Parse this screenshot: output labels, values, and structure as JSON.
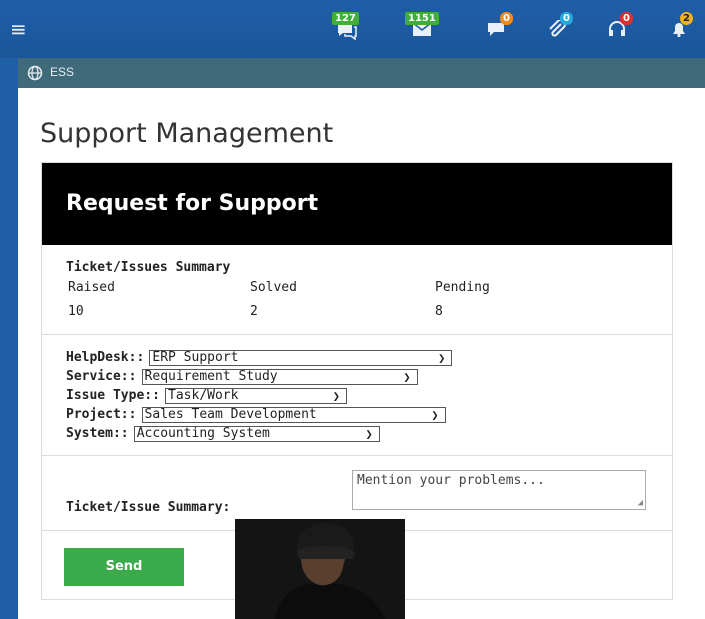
{
  "navbar": {
    "menu_icon": "hamburger-icon",
    "icons": [
      {
        "name": "messages",
        "icon": "chat-icon",
        "badge": "127",
        "badge_color": "#3fae3a"
      },
      {
        "name": "mail",
        "icon": "envelope-icon",
        "badge": "1151",
        "badge_color": "#3fae3a"
      },
      {
        "name": "comments",
        "icon": "comment-icon",
        "badge": "0",
        "badge_color": "#f08a1c"
      },
      {
        "name": "attachments",
        "icon": "paperclip-icon",
        "badge": "0",
        "badge_color": "#23a8e0"
      },
      {
        "name": "support",
        "icon": "headset-icon",
        "badge": "0",
        "badge_color": "#d8322f"
      },
      {
        "name": "alerts",
        "icon": "bell-icon",
        "badge": "2",
        "badge_color": "#f2b21a"
      }
    ]
  },
  "breadcrumb": {
    "icon": "globe-icon",
    "label": "ESS"
  },
  "page": {
    "title": "Support Management",
    "panel_title": "Request for Support"
  },
  "summary": {
    "title": "Ticket/Issues Summary",
    "stats": [
      {
        "label": "Raised",
        "value": "10"
      },
      {
        "label": "Solved",
        "value": "2"
      },
      {
        "label": "Pending",
        "value": "8"
      }
    ]
  },
  "form": {
    "helpdesk": {
      "label": "HelpDesk::",
      "value": "ERP Support"
    },
    "service": {
      "label": "Service::",
      "value": "Requirement Study"
    },
    "issue_type": {
      "label": "Issue Type::",
      "value": "Task/Work"
    },
    "project": {
      "label": "Project::",
      "value": "Sales Team Development"
    },
    "system": {
      "label": "System::",
      "value": "Accounting System"
    },
    "summary_label": "Ticket/Issue Summary:",
    "summary_placeholder": "Mention your problems..."
  },
  "actions": {
    "send_label": "Send"
  },
  "colors": {
    "navbar": "#1f5ea8",
    "breadcrumb_bar": "#3f6a79",
    "panel_header": "#000000",
    "send_button": "#3aaa4a"
  }
}
